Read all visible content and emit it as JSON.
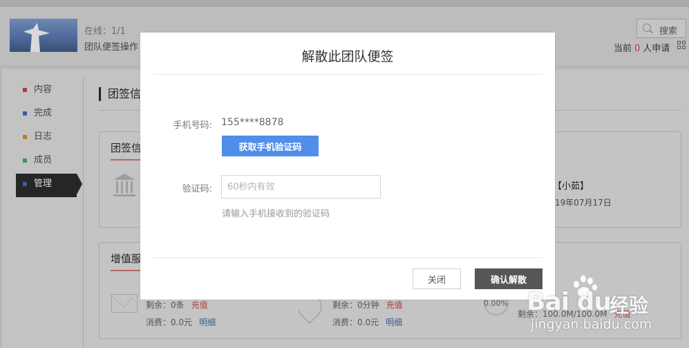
{
  "header": {
    "online": "在线：1/1",
    "ops": "团队便签操作",
    "search_label": "搜索",
    "apply_prefix": "当前",
    "apply_count": "0",
    "apply_suffix": "人申请"
  },
  "sidebar": {
    "items": [
      {
        "label": "内容",
        "color": "#b03a3a"
      },
      {
        "label": "完成",
        "color": "#3b5ca8"
      },
      {
        "label": "日志",
        "color": "#c07a2a"
      },
      {
        "label": "成员",
        "color": "#2f9a4e"
      },
      {
        "label": "管理",
        "color": "#3b5ca8"
      }
    ]
  },
  "main": {
    "section_title": "团签信",
    "info_card": {
      "title": "团签信",
      "owner": "【小茹】",
      "date": "19年07月17日"
    },
    "value_card": {
      "title": "增值服",
      "sms": {
        "remain": "剩余：0条",
        "recharge": "充值",
        "spent": "消费：0.0元",
        "detail": "明细"
      },
      "call": {
        "remain": "剩余：0分钟",
        "recharge": "充值",
        "spent": "消费：0.0元",
        "detail": "明细"
      },
      "storage": {
        "percent": "0.00%",
        "remain": "剩余：100.0M/100.0M",
        "recharge": "充值"
      }
    }
  },
  "modal": {
    "title": "解散此团队便签",
    "phone_label": "手机号码:",
    "phone_value": "155****8878",
    "get_code_label": "获取手机验证码",
    "code_label": "验证码:",
    "code_placeholder": "60秒内有效",
    "code_hint": "请输入手机接收到的验证码",
    "close_label": "关闭",
    "confirm_label": "确认解散"
  },
  "watermark": {
    "brand": "Bai du",
    "suffix": "经验",
    "url": "jingyan.baidu.com"
  },
  "colors": {
    "primary": "#4f8ee9",
    "dark_button": "#565656",
    "alert_red": "#b83a3a"
  }
}
